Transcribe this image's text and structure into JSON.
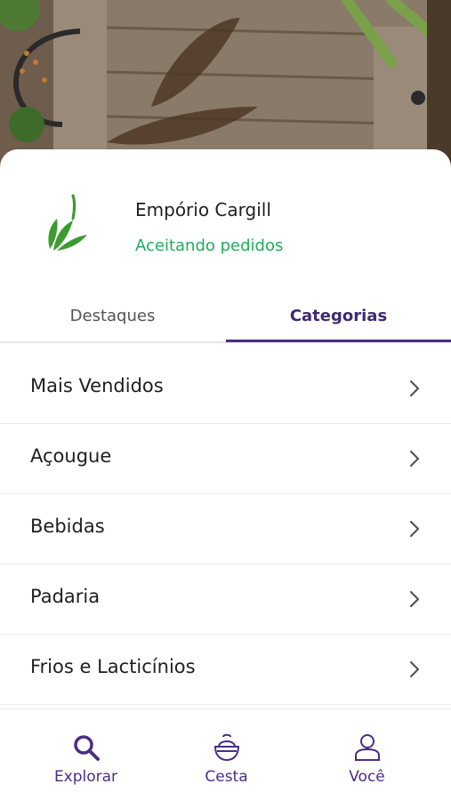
{
  "store": {
    "name": "Empório Cargill",
    "status": "Aceitando pedidos"
  },
  "tabs": [
    {
      "label": "Destaques",
      "active": false
    },
    {
      "label": "Categorias",
      "active": true
    }
  ],
  "categories": [
    {
      "label": "Mais Vendidos"
    },
    {
      "label": "Açougue"
    },
    {
      "label": "Bebidas"
    },
    {
      "label": "Padaria"
    },
    {
      "label": "Frios e Lacticínios"
    }
  ],
  "bottom_nav": [
    {
      "label": "Explorar",
      "icon": "search-icon",
      "active": true
    },
    {
      "label": "Cesta",
      "icon": "basket-icon",
      "active": false
    },
    {
      "label": "Você",
      "icon": "user-icon",
      "active": false
    }
  ],
  "colors": {
    "accent": "#4b2e83",
    "status": "#1fae5b",
    "logo": "#3b9b2f"
  }
}
